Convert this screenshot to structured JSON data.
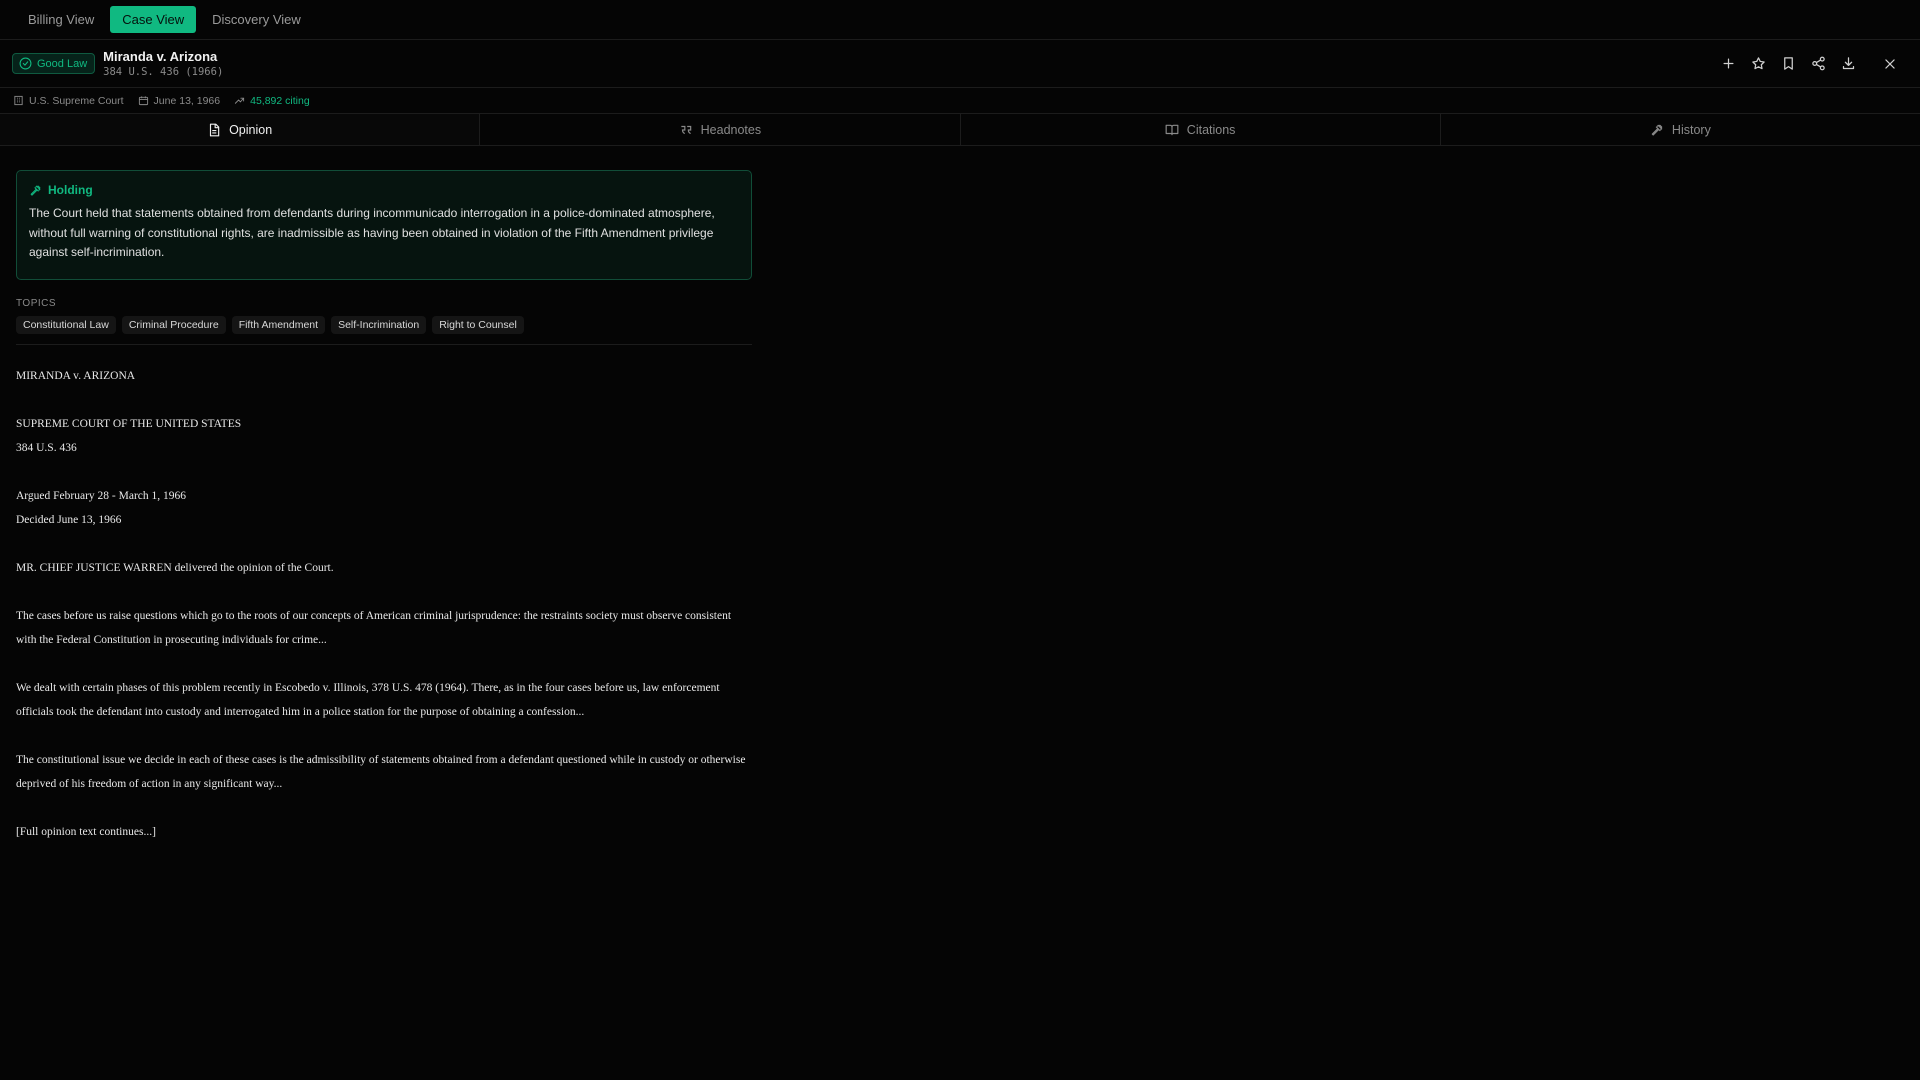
{
  "topnav": {
    "tabs": [
      {
        "label": "Billing View"
      },
      {
        "label": "Case View"
      },
      {
        "label": "Discovery View"
      }
    ]
  },
  "case": {
    "status": "Good Law",
    "title": "Miranda v. Arizona",
    "citation": "384 U.S. 436 (1966)"
  },
  "meta": {
    "court": "U.S. Supreme Court",
    "date": "June 13, 1966",
    "citing": "45,892 citing"
  },
  "sections": [
    {
      "label": "Opinion",
      "icon": "document-icon"
    },
    {
      "label": "Headnotes",
      "icon": "quote-icon"
    },
    {
      "label": "Citations",
      "icon": "book-open-icon"
    },
    {
      "label": "History",
      "icon": "gavel-icon"
    }
  ],
  "holding": {
    "label": "Holding",
    "text": "The Court held that statements obtained from defendants during incommunicado interrogation in a police-dominated atmosphere, without full warning of constitutional rights, are inadmissible as having been obtained in violation of the Fifth Amendment privilege against self-incrimination."
  },
  "topics": {
    "label": "TOPICS",
    "items": [
      "Constitutional Law",
      "Criminal Procedure",
      "Fifth Amendment",
      "Self-Incrimination",
      "Right to Counsel"
    ]
  },
  "opinion": {
    "caption": "MIRANDA v. ARIZONA",
    "court": "SUPREME COURT OF THE UNITED STATES",
    "reporter": "384 U.S. 436",
    "argued": "Argued February 28 - March 1, 1966",
    "decided": "Decided June 13, 1966",
    "author": "MR. CHIEF JUSTICE WARREN delivered the opinion of the Court.",
    "para1": "The cases before us raise questions which go to the roots of our concepts of American criminal jurisprudence: the restraints society must observe consistent with the Federal Constitution in prosecuting individuals for crime...",
    "para2": "We dealt with certain phases of this problem recently in Escobedo v. Illinois, 378 U.S. 478 (1964). There, as in the four cases before us, law enforcement officials took the defendant into custody and interrogated him in a police station for the purpose of obtaining a confession...",
    "para3": "The constitutional issue we decide in each of these cases is the admissibility of statements obtained from a defendant questioned while in custody or otherwise deprived of his freedom of action in any significant way...",
    "continues": "[Full opinion text continues...]"
  },
  "colors": {
    "accent": "#10b981",
    "background": "#050505"
  }
}
